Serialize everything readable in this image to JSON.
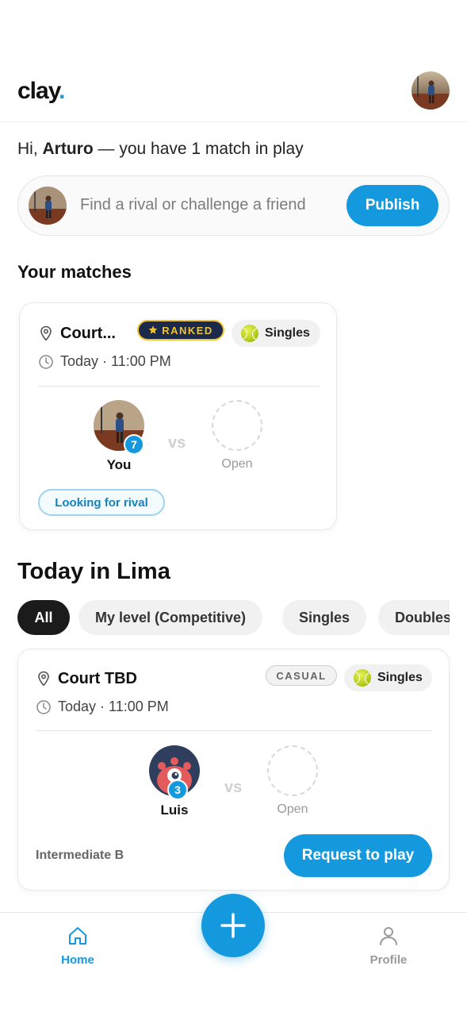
{
  "app": {
    "logo_text": "clay",
    "logo_dot": ".",
    "accent_color": "#1499de"
  },
  "greeting": {
    "prefix": "Hi, ",
    "name": "Arturo",
    "suffix": " — you have 1 match in play"
  },
  "composer": {
    "placeholder": "Find a rival or challenge a friend",
    "publish_label": "Publish"
  },
  "your_matches": {
    "title": "Your matches",
    "card": {
      "location": "Court...",
      "tag": "RANKED",
      "type": "Singles",
      "time": "Today · 11:00 PM",
      "player": {
        "name": "You",
        "level": "7"
      },
      "vs": "vs",
      "opponent_label": "Open",
      "status": "Looking for rival"
    }
  },
  "today": {
    "title": "Today in Lima",
    "filters": [
      "All",
      "My level (Competitive)",
      "Singles",
      "Doubles"
    ],
    "active_filter": "All",
    "card": {
      "location": "Court TBD",
      "tag": "CASUAL",
      "type": "Singles",
      "time": "Today · 11:00 PM",
      "player": {
        "name": "Luis",
        "level": "3"
      },
      "vs": "vs",
      "opponent_label": "Open",
      "level_text": "Intermediate B",
      "request_label": "Request to play"
    }
  },
  "tabbar": {
    "home_label": "Home",
    "profile_label": "Profile",
    "fab_icon": "plus-icon"
  }
}
